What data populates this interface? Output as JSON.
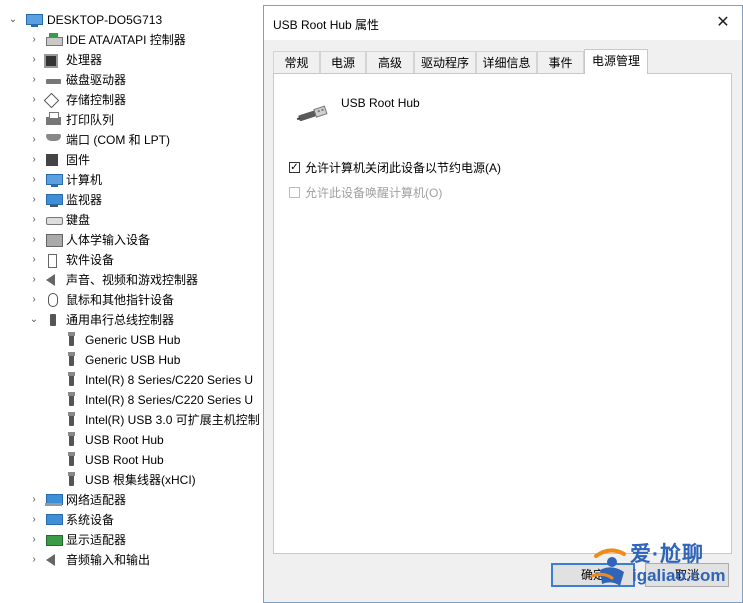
{
  "tree": {
    "root": "DESKTOP-DO5G713",
    "items": [
      {
        "label": "IDE ATA/ATAPI 控制器",
        "icon": "ide-controller-icon",
        "expanded": false
      },
      {
        "label": "处理器",
        "icon": "processor-icon",
        "expanded": false
      },
      {
        "label": "磁盘驱动器",
        "icon": "disk-drive-icon",
        "expanded": false
      },
      {
        "label": "存储控制器",
        "icon": "storage-controller-icon",
        "expanded": false
      },
      {
        "label": "打印队列",
        "icon": "printer-icon",
        "expanded": false
      },
      {
        "label": "端口 (COM 和 LPT)",
        "icon": "port-icon",
        "expanded": false
      },
      {
        "label": "固件",
        "icon": "firmware-icon",
        "expanded": false
      },
      {
        "label": "计算机",
        "icon": "computer-icon",
        "expanded": false
      },
      {
        "label": "监视器",
        "icon": "monitor-icon",
        "expanded": false
      },
      {
        "label": "键盘",
        "icon": "keyboard-icon",
        "expanded": false
      },
      {
        "label": "人体学输入设备",
        "icon": "hid-icon",
        "expanded": false
      },
      {
        "label": "软件设备",
        "icon": "software-device-icon",
        "expanded": false
      },
      {
        "label": "声音、视频和游戏控制器",
        "icon": "sound-icon",
        "expanded": false
      },
      {
        "label": "鼠标和其他指针设备",
        "icon": "mouse-icon",
        "expanded": false
      },
      {
        "label": "通用串行总线控制器",
        "icon": "usb-controller-icon",
        "expanded": true
      },
      {
        "label": "网络适配器",
        "icon": "network-adapter-icon",
        "expanded": false
      },
      {
        "label": "系统设备",
        "icon": "system-device-icon",
        "expanded": false
      },
      {
        "label": "显示适配器",
        "icon": "display-adapter-icon",
        "expanded": false
      },
      {
        "label": "音频输入和输出",
        "icon": "audio-icon",
        "expanded": false
      }
    ],
    "usb_children": [
      "Generic USB Hub",
      "Generic USB Hub",
      "Intel(R) 8 Series/C220 Series  U",
      "Intel(R) 8 Series/C220 Series  U",
      "Intel(R) USB 3.0 可扩展主机控制",
      "USB Root Hub",
      "USB Root Hub",
      "USB 根集线器(xHCI)"
    ]
  },
  "dialog": {
    "title": "USB Root Hub 属性",
    "close_label": "✕",
    "tabs": [
      "常规",
      "电源",
      "高级",
      "驱动程序",
      "详细信息",
      "事件",
      "电源管理"
    ],
    "active_tab": 6,
    "device_name": "USB Root Hub",
    "options": [
      {
        "label": "允许计算机关闭此设备以节约电源(A)",
        "checked": true,
        "enabled": true
      },
      {
        "label": "允许此设备唤醒计算机(O)",
        "checked": false,
        "enabled": false
      }
    ],
    "ok_label": "确定",
    "cancel_label": "取消"
  },
  "watermark": {
    "line1": "爱·尬聊",
    "line2": "igaliao.com"
  }
}
